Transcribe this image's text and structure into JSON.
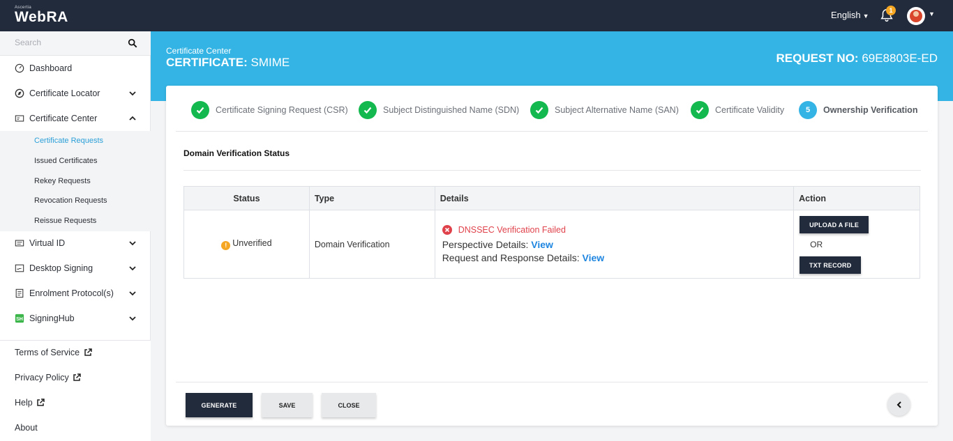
{
  "brand": {
    "vendor": "Ascertia",
    "name": "WebRA"
  },
  "header": {
    "language": "English",
    "notification_count": "1"
  },
  "sidebar": {
    "search_placeholder": "Search",
    "items": [
      {
        "label": "Dashboard",
        "icon": "dashboard-icon"
      },
      {
        "label": "Certificate Locator",
        "icon": "compass-icon"
      },
      {
        "label": "Certificate Center",
        "icon": "id-card-icon"
      },
      {
        "label": "Virtual ID",
        "icon": "virtual-id-icon"
      },
      {
        "label": "Desktop Signing",
        "icon": "desktop-signing-icon"
      },
      {
        "label": "Enrolment Protocol(s)",
        "icon": "enrolment-icon"
      },
      {
        "label": "SigningHub",
        "icon": "signinghub-icon"
      }
    ],
    "subitems": [
      {
        "label": "Certificate Requests",
        "active": true
      },
      {
        "label": "Issued Certificates"
      },
      {
        "label": "Rekey Requests"
      },
      {
        "label": "Revocation Requests"
      },
      {
        "label": "Reissue Requests"
      }
    ],
    "footer": [
      {
        "label": "Terms of Service"
      },
      {
        "label": "Privacy Policy"
      },
      {
        "label": "Help"
      },
      {
        "label": "About"
      }
    ]
  },
  "banner": {
    "crumb": "Certificate Center",
    "title_prefix": "CERTIFICATE:",
    "title_value": "SMIME",
    "request_label": "REQUEST NO:",
    "request_value": "69E8803E-ED"
  },
  "steps": [
    {
      "label": "Certificate Signing Request (CSR)",
      "done": true
    },
    {
      "label": "Subject Distinguished Name (SDN)",
      "done": true
    },
    {
      "label": "Subject Alternative Name (SAN)",
      "done": true
    },
    {
      "label": "Certificate Validity",
      "done": true
    },
    {
      "label": "Ownership Verification",
      "number": "5",
      "current": true
    }
  ],
  "section_title": "Domain Verification Status",
  "table": {
    "headers": [
      "Status",
      "Type",
      "Details",
      "Action"
    ],
    "row": {
      "status": "Unverified",
      "type": "Domain Verification",
      "fail_message": "DNSSEC Verification Failed",
      "perspective_label": "Perspective Details:",
      "perspective_link": "View",
      "reqresp_label": "Request and Response Details:",
      "reqresp_link": "View",
      "upload_button": "UPLOAD A FILE",
      "or_text": "OR",
      "txt_button": "TXT RECORD"
    }
  },
  "footer_buttons": {
    "generate": "GENERATE",
    "save": "SAVE",
    "close": "CLOSE"
  },
  "colors": {
    "topbar": "#222b3c",
    "accent": "#34b4e4",
    "success": "#13b84f",
    "error": "#e0424b",
    "warning": "#f5a623",
    "link": "#1f86e0"
  }
}
